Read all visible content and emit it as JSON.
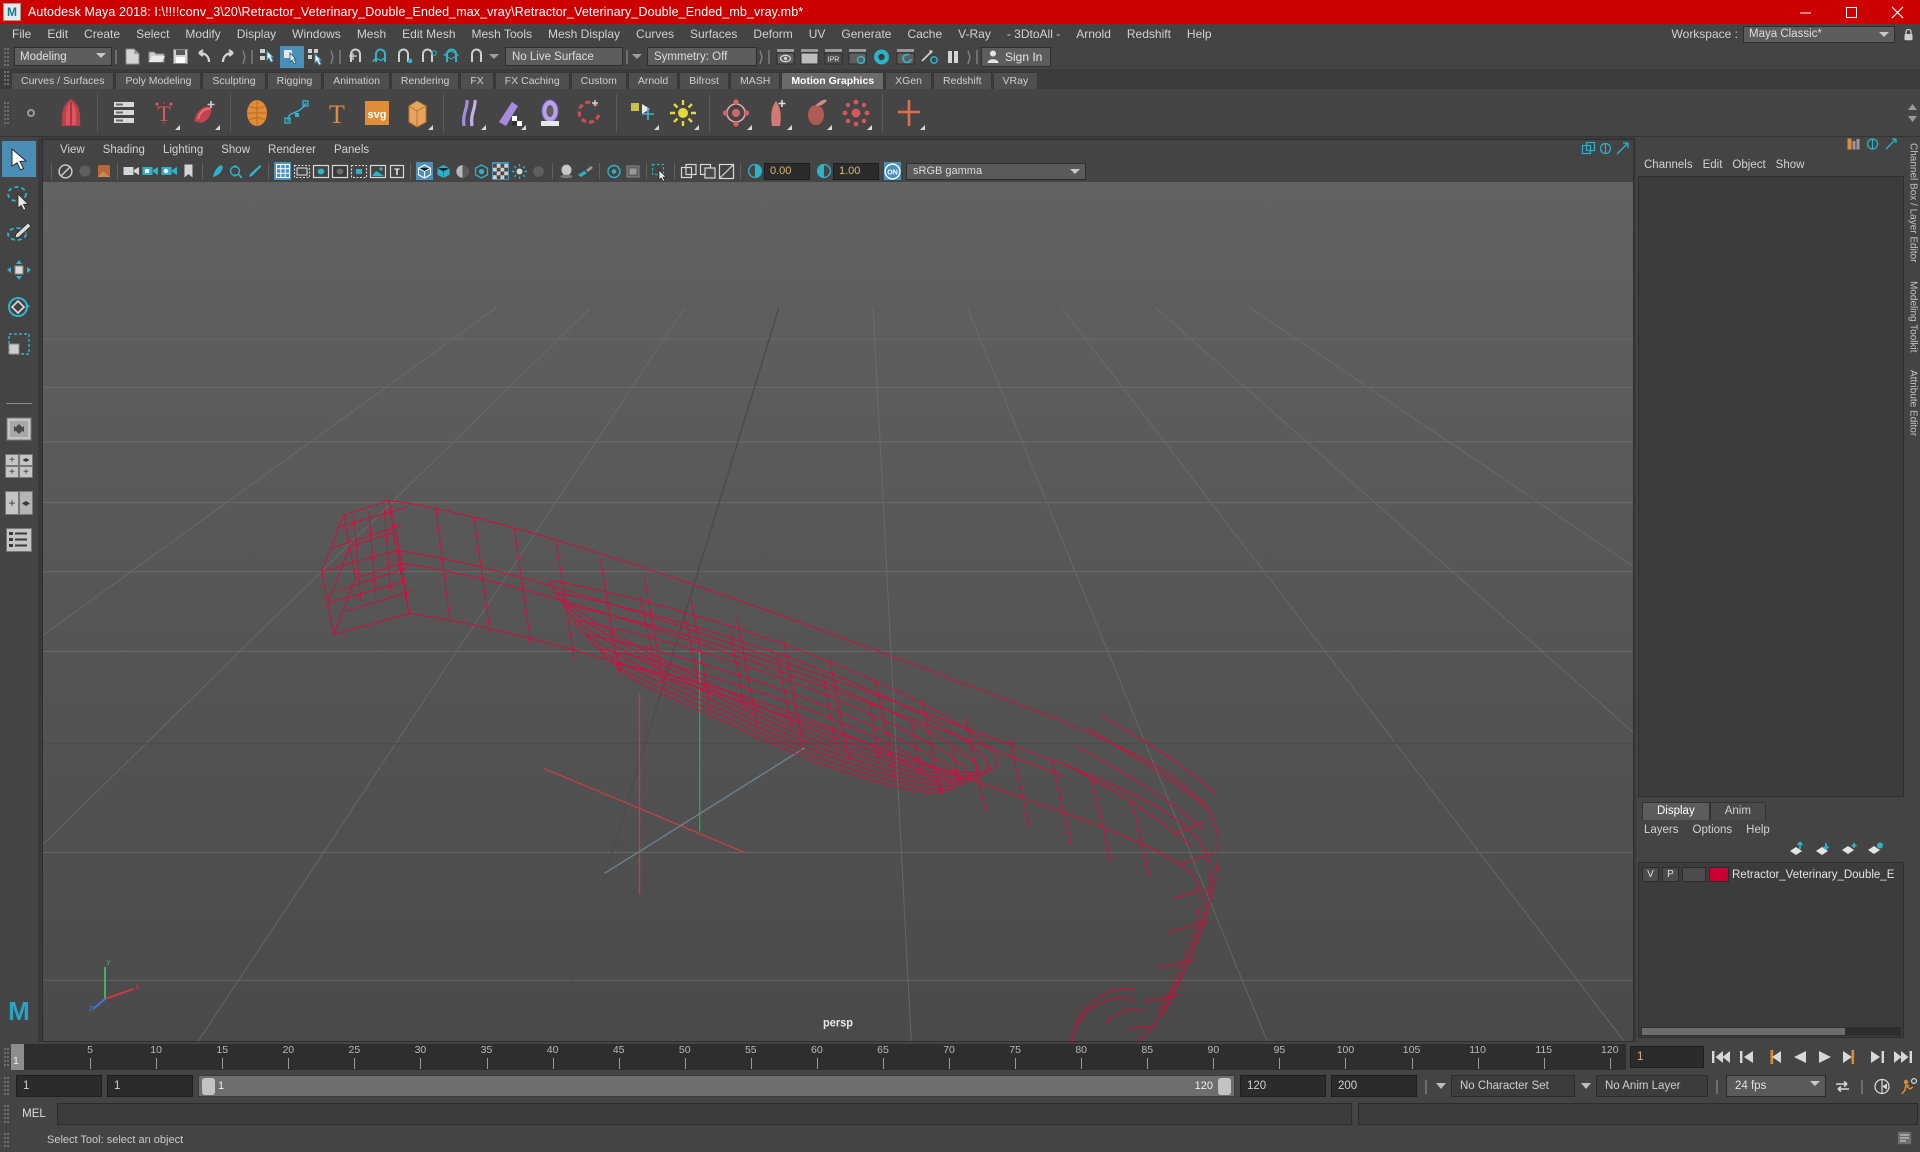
{
  "titlebar": {
    "title": "Autodesk Maya 2018: I:\\!!!!conv_3\\20\\Retractor_Veterinary_Double_Ended_max_vray\\Retractor_Veterinary_Double_Ended_mb_vray.mb*",
    "logo_letter": "M",
    "minimize": "—",
    "maximize": "❐",
    "close": "✕",
    "bg_color": "#cc0000"
  },
  "menubar": {
    "items": [
      "File",
      "Edit",
      "Create",
      "Select",
      "Modify",
      "Display",
      "Windows",
      "Mesh",
      "Edit Mesh",
      "Mesh Tools",
      "Mesh Display",
      "Curves",
      "Surfaces",
      "Deform",
      "UV",
      "Generate",
      "Cache",
      "V-Ray",
      "- 3DtoAll -",
      "Arnold",
      "Redshift",
      "Help"
    ],
    "workspace_label": "Workspace :",
    "workspace_value": "Maya Classic*"
  },
  "statusline": {
    "mode": "Modeling",
    "live_surface": "No Live Surface",
    "symmetry": "Symmetry: Off",
    "signin": "Sign In",
    "icons": [
      "new-scene-icon",
      "open-scene-icon",
      "save-scene-icon",
      "undo-icon",
      "redo-icon",
      "select-hierarchy-icon",
      "select-object-icon",
      "select-component-icon",
      "snap-grid-icon",
      "snap-curve-icon",
      "snap-point-icon",
      "snap-projected-center-icon",
      "snap-view-plane-icon",
      "make-live-icon",
      "render-view-icon",
      "render-region-icon",
      "ipr-render-icon",
      "render-settings-icon",
      "hypershade-icon",
      "render-setup-icon",
      "light-linking-icon",
      "pause-render-icon"
    ]
  },
  "shelf": {
    "tabs": [
      "Curves / Surfaces",
      "Poly Modeling",
      "Sculpting",
      "Rigging",
      "Animation",
      "Rendering",
      "FX",
      "FX Caching",
      "Custom",
      "Arnold",
      "Bifrost",
      "MASH",
      "Motion Graphics",
      "XGen",
      "Redshift",
      "VRay"
    ],
    "active_tab": "Motion Graphics",
    "icons": [
      "mash-network-icon",
      "mash-waiter-icon",
      "mash-text-icon",
      "mash-trails-icon",
      "mash-sphere-icon",
      "mash-curve-icon",
      "mash-type-icon",
      "mash-svg-icon",
      "mash-boolean-icon",
      "mash-curve-node-icon",
      "mash-paint-icon",
      "mash-signal-icon",
      "mash-dynamics-icon",
      "mash-grid-icon",
      "mash-radial-icon",
      "mash-distribute-icon",
      "mash-replicate-icon",
      "mash-orient-icon",
      "mash-explode-icon",
      "mash-merge-icon"
    ]
  },
  "toolbox": {
    "items": [
      "select-tool",
      "lasso-select-tool",
      "paint-select-tool",
      "move-tool",
      "rotate-tool",
      "scale-tool",
      "last-tool",
      "quad-view-layout",
      "four-pane-layout",
      "two-pane-layout",
      "outliner-persp-layout"
    ],
    "logo_letter": "M"
  },
  "viewport": {
    "menus": [
      "View",
      "Shading",
      "Lighting",
      "Show",
      "Renderer",
      "Panels"
    ],
    "camera_label": "persp",
    "exposure": "0.00",
    "gamma": "1.00",
    "color_space": "sRGB gamma",
    "toolbar_icons": [
      "select-camera-icon",
      "no-camera-icon",
      "bookmark-icon",
      "image-plane-icon",
      "camera-attr-icon",
      "camera-lock-icon",
      "camera-settings-icon",
      "grid-icon",
      "film-gate-icon",
      "resolution-gate-icon",
      "gate-mask-icon",
      "exposure-icon",
      "gamma-icon",
      "xray-icon",
      "wireframe-icon",
      "smooth-shade-icon",
      "shaded-wireframe-icon",
      "textured-icon",
      "lighting-icon",
      "shadows-icon",
      "ao-icon",
      "motion-blur-icon",
      "isolate-select-icon"
    ],
    "model_color": "#e8003c",
    "model_name": "Retractor_Veterinary_Double_Ended"
  },
  "right_panel": {
    "channel_menus": [
      "Channels",
      "Edit",
      "Object",
      "Show"
    ],
    "sidebar_labels": [
      "Channel Box / Layer Editor",
      "Modeling Toolkit",
      "Attribute Editor"
    ],
    "layer_tabs": [
      "Display",
      "Anim"
    ],
    "layer_active_tab": "Display",
    "layer_menus": [
      "Layers",
      "Options",
      "Help"
    ],
    "layer_rows": [
      {
        "v": "V",
        "p": "P",
        "blank": "",
        "color": "#cc0033",
        "name": "Retractor_Veterinary_Double_E"
      }
    ]
  },
  "timeslider": {
    "tick_labels": [
      "5",
      "10",
      "15",
      "20",
      "25",
      "30",
      "35",
      "40",
      "45",
      "50",
      "55",
      "60",
      "65",
      "70",
      "75",
      "80",
      "85",
      "90",
      "95",
      "100",
      "105",
      "110",
      "115",
      "120"
    ],
    "current_frame": "1",
    "end_display": "120",
    "current_field": "1",
    "playback_buttons": [
      "go-to-start-icon",
      "step-back-frame-icon",
      "step-back-key-icon",
      "play-backwards-icon",
      "play-forwards-icon",
      "step-forward-key-icon",
      "step-forward-frame-icon",
      "go-to-end-icon"
    ]
  },
  "rangebar": {
    "anim_start": "1",
    "range_start": "1",
    "slider_start_label": "1",
    "slider_end_label": "120",
    "range_end": "120",
    "anim_end": "200",
    "character_set": "No Character Set",
    "anim_layer": "No Anim Layer",
    "fps": "24 fps",
    "right_icons": [
      "loop-playback-icon",
      "auto-key-icon",
      "animation-preferences-icon"
    ]
  },
  "commandline": {
    "mel_label": "MEL",
    "input_value": "",
    "output_value": ""
  },
  "helpline": {
    "text": "Select Tool: select an object"
  }
}
